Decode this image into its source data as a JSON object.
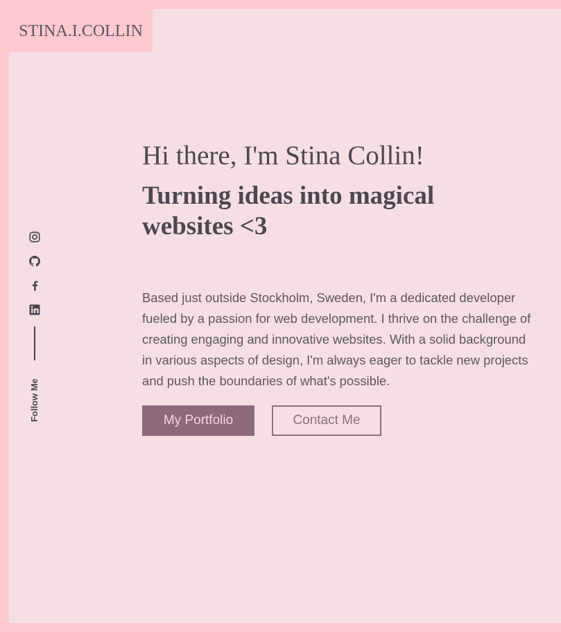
{
  "header": {
    "brand": "STINA.I.COLLIN"
  },
  "social": {
    "icons": [
      "instagram-icon",
      "github-icon",
      "facebook-icon",
      "linkedin-icon"
    ],
    "follow_label": "Follow Me"
  },
  "hero": {
    "greeting": "Hi there, I'm Stina Collin!",
    "tagline": "Turning ideas into magical websites <3",
    "bio": "Based just outside Stockholm, Sweden, I'm a dedicated developer fueled by a passion for web development. I thrive on the challenge of creating engaging and innovative websites. With a solid background in various aspects of design, I'm always eager to tackle new projects and push the boundaries of what's possible.",
    "primary_button": "My Portfolio",
    "secondary_button": "Contact Me"
  },
  "colors": {
    "frame": "#fdc9d0",
    "background": "#f5dfe5",
    "text": "#4e4750",
    "accent": "#8c6a7b"
  }
}
